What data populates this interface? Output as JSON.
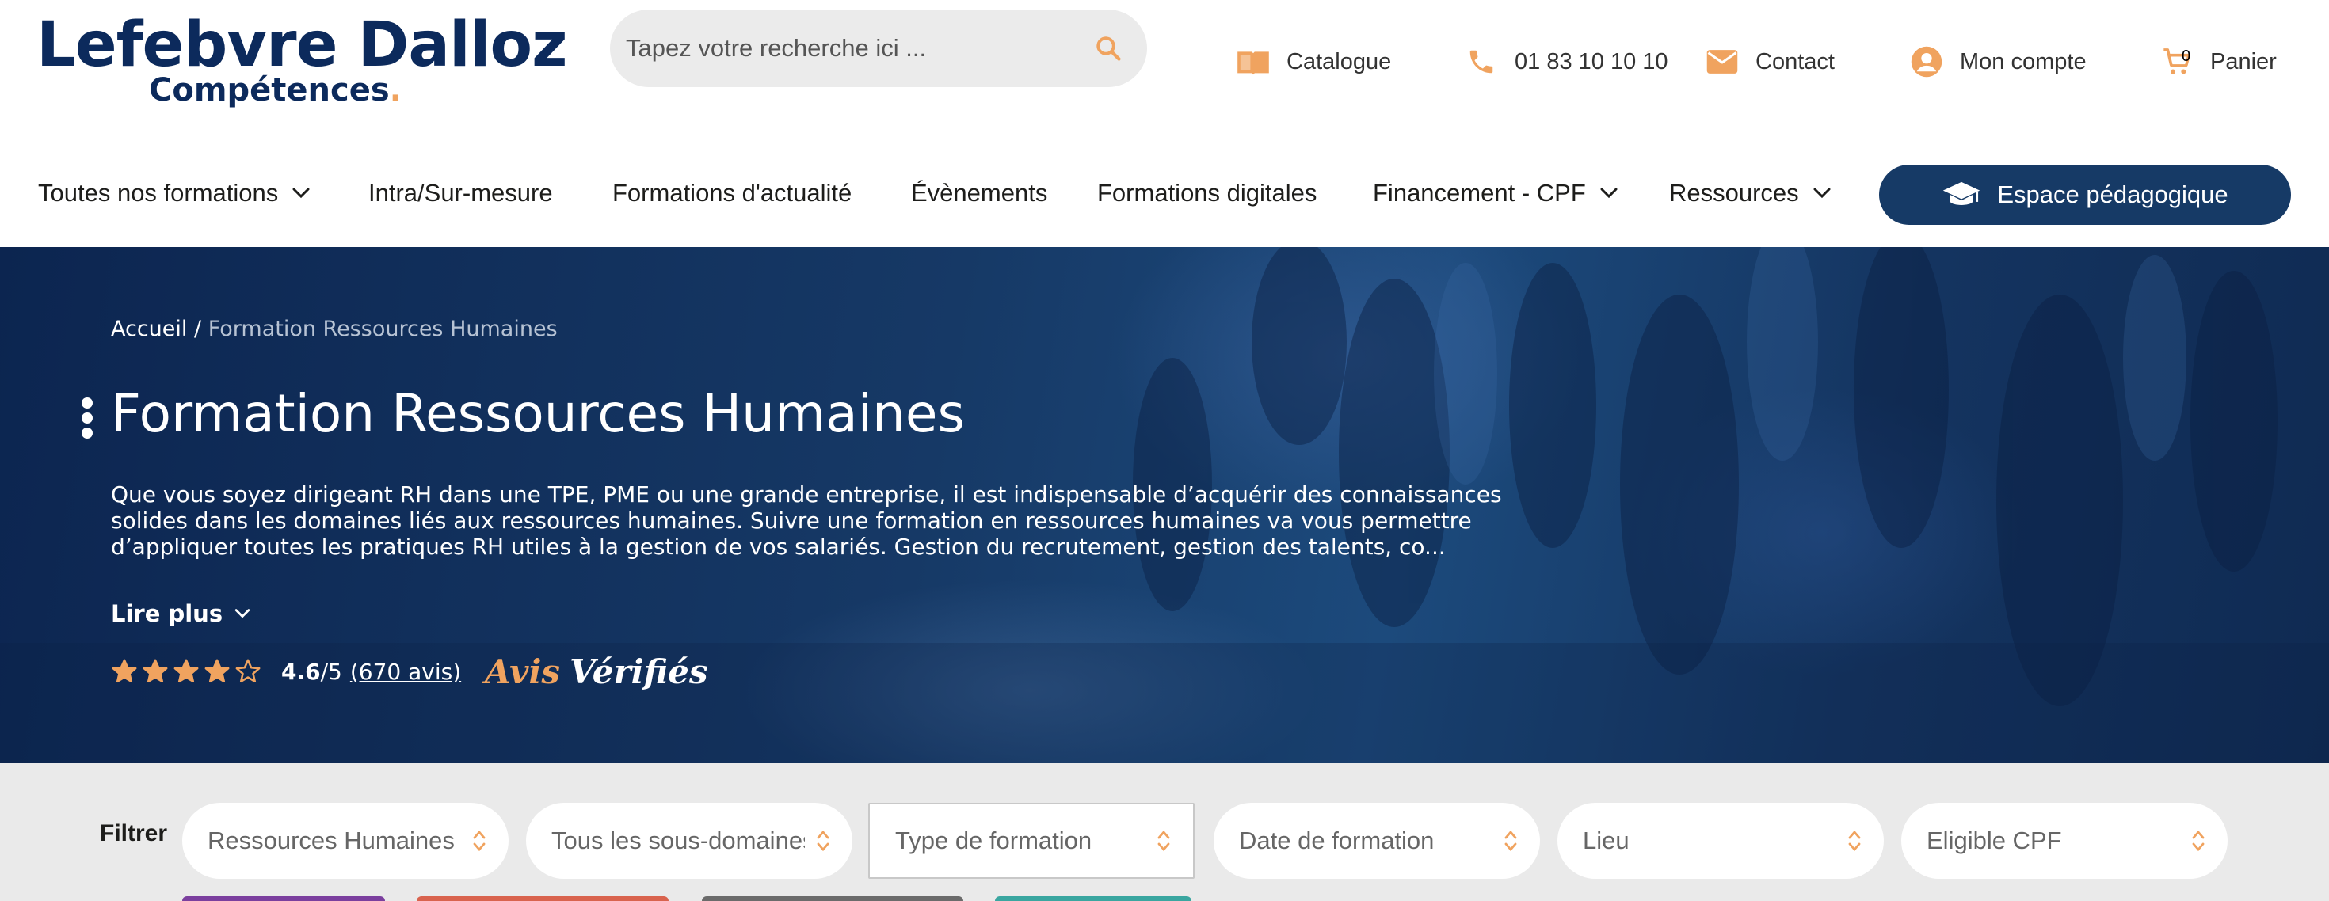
{
  "header": {
    "logo": {
      "main": "Lefebvre Dalloz",
      "sub": "Compétences",
      "sub_dot": "."
    },
    "search": {
      "placeholder": "Tapez votre recherche ici ..."
    },
    "links": [
      {
        "label": "Catalogue",
        "icon": "book-icon"
      },
      {
        "label": "01 83 10 10 10",
        "icon": "phone-icon"
      },
      {
        "label": "Contact",
        "icon": "mail-icon"
      },
      {
        "label": "Mon compte",
        "icon": "user-icon"
      },
      {
        "label": "Panier",
        "icon": "cart-icon",
        "count": "0"
      }
    ],
    "nav": [
      {
        "label": "Toutes nos formations",
        "has_dropdown": true
      },
      {
        "label": "Intra/Sur-mesure",
        "has_dropdown": false
      },
      {
        "label": "Formations d'actualité",
        "has_dropdown": false
      },
      {
        "label": "Évènements",
        "has_dropdown": false
      },
      {
        "label": "Formations digitales",
        "has_dropdown": false
      },
      {
        "label": "Financement - CPF",
        "has_dropdown": true
      },
      {
        "label": "Ressources",
        "has_dropdown": true
      }
    ],
    "espace_button": {
      "label": "Espace pédagogique",
      "icon": "graduation-cap-icon"
    }
  },
  "hero": {
    "breadcrumb": {
      "home": "Accueil",
      "separator": " / ",
      "current": "Formation Ressources Humaines"
    },
    "title": "Formation Ressources Humaines",
    "description": "Que vous soyez dirigeant RH dans une TPE, PME ou une grande entreprise, il est indispensable d’acquérir des connaissances solides dans les domaines liés aux ressources humaines. Suivre une formation en ressources humaines va vous permettre d’appliquer toutes les pratiques RH utiles à la gestion de vos salariés. Gestion du recrutement, gestion des talents, co...",
    "read_more": "Lire plus",
    "rating": {
      "stars": 4,
      "max_stars": 5,
      "score": "4.6",
      "out_of": "/5",
      "reviews": "(670 avis)",
      "brand_a": "Avis",
      "brand_b": "Vérifiés"
    }
  },
  "filters": {
    "label": "Filtrer",
    "selects": [
      {
        "value": "Ressources Humaines"
      },
      {
        "value": "Tous les sous-domaines"
      },
      {
        "value": "Type de formation"
      },
      {
        "value": "Date de formation"
      },
      {
        "value": "Lieu"
      },
      {
        "value": "Eligible CPF"
      }
    ]
  },
  "colors": {
    "brand_navy": "#0c2a5c",
    "accent_orange": "#f0a35f",
    "button_blue": "#163a66"
  }
}
